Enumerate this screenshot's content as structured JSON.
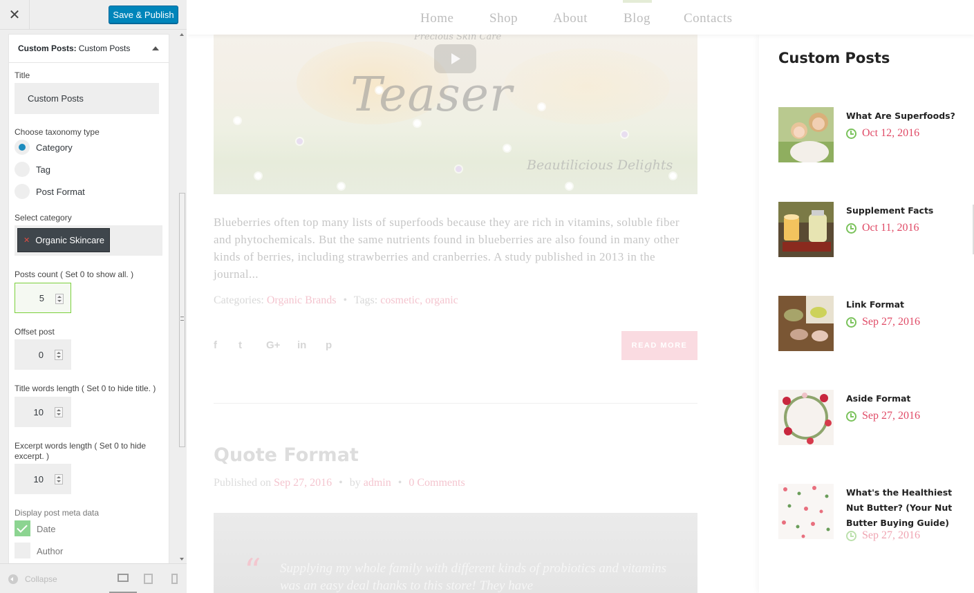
{
  "customizer": {
    "close_label": "✕",
    "save_label": "Save & Publish",
    "section_prefix": "Custom Posts:",
    "section_name": "Custom Posts",
    "title_label": "Title",
    "title_value": "Custom Posts",
    "taxonomy_label": "Choose taxonomy type",
    "taxonomy_options": [
      "Category",
      "Tag",
      "Post Format"
    ],
    "taxonomy_selected": "Category",
    "select_category_label": "Select category",
    "selected_category": "Organic Skincare",
    "posts_count_label": "Posts count ( Set 0 to show all. )",
    "posts_count_value": "5",
    "offset_label": "Offset post",
    "offset_value": "0",
    "title_words_label": "Title words length ( Set 0 to hide title. )",
    "title_words_value": "10",
    "excerpt_words_label": "Excerpt words length ( Set 0 to hide excerpt. )",
    "excerpt_words_value": "10",
    "meta_label": "Display post meta data",
    "meta_options": [
      {
        "label": "Date",
        "checked": true
      },
      {
        "label": "Author",
        "checked": false
      }
    ],
    "collapse_label": "Collapse"
  },
  "nav": {
    "items": [
      "Home",
      "Shop",
      "About",
      "Blog",
      "Contacts"
    ],
    "active": "Blog"
  },
  "post1": {
    "teaser_top": "Precious Skin Care",
    "teaser_title": "Teaser",
    "teaser_sub": "Beautilicious Delights",
    "excerpt": "Blueberries often top many lists of superfoods because they are rich in vitamins, soluble fiber and phytochemicals. But the same nutrients found in blueberries are also found in many other kinds of berries, including strawberries and cranberries. A study published in 2013 in the journal...",
    "categories_label": "Categories:",
    "category": "Organic Brands",
    "tags_label": "Tags:",
    "tags": "cosmetic, organic",
    "social_icons": [
      "f",
      "t",
      "G+",
      "in",
      "p"
    ],
    "read_more": "READ MORE"
  },
  "post2": {
    "title": "Quote Format",
    "published_label": "Published on",
    "date": "Sep 27, 2016",
    "by_label": "by",
    "author": "admin",
    "comments": "0 Comments",
    "quote_mark": "“",
    "quote": "Supplying my whole family with different kinds of probiotics and vitamins was an easy deal thanks to this store! They have"
  },
  "widget": {
    "title": "Custom Posts",
    "posts": [
      {
        "title": "What Are Superfoods?",
        "date": "Oct 12, 2016"
      },
      {
        "title": "Supplement Facts",
        "date": "Oct 11, 2016"
      },
      {
        "title": "Link Format",
        "date": "Sep 27, 2016"
      },
      {
        "title": "Aside Format",
        "date": "Sep 27, 2016"
      },
      {
        "title": "What's the Healthiest Nut Butter? (Your Nut Butter Buying Guide)",
        "date": "Sep 27, 2016"
      }
    ]
  },
  "colors": {
    "accent_pink": "#e04a66",
    "clock_green": "#7ac25b",
    "publish_blue": "#0085ba"
  }
}
